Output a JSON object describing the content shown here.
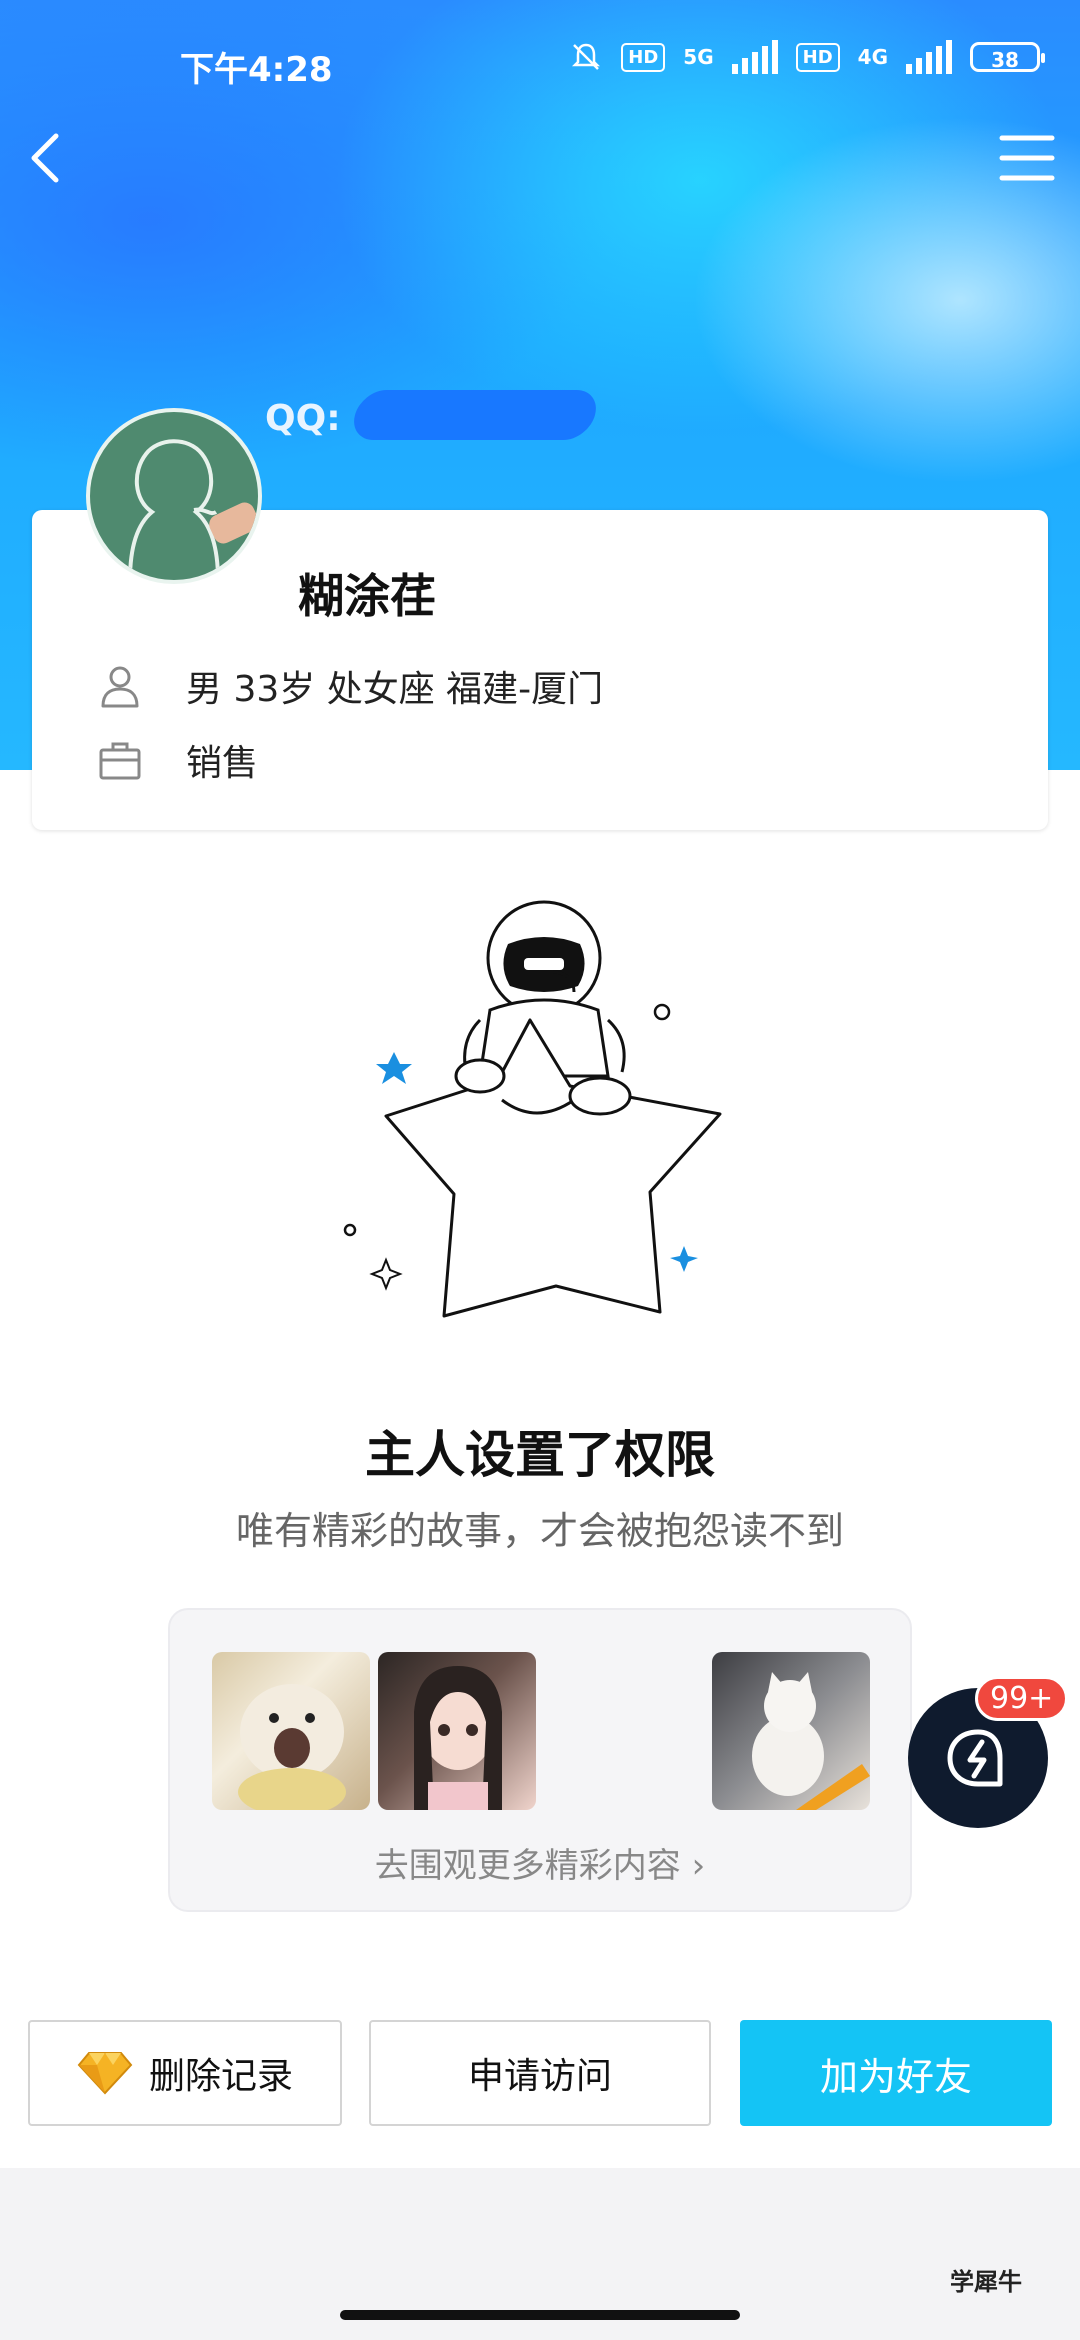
{
  "status_bar": {
    "time": "下午4:28",
    "network_1": "5G",
    "network_2": "4G",
    "hd_1": "HD",
    "hd_2": "HD",
    "battery": "38"
  },
  "header": {
    "qq_label": "QQ:"
  },
  "profile": {
    "nickname": "糊涂荏",
    "basic_info": "男  33岁  处女座  福建-厦门",
    "occupation": "销售"
  },
  "privacy": {
    "title": "主人设置了权限",
    "subtitle": "唯有精彩的故事，才会被抱怨读不到"
  },
  "discover": {
    "link_text": "去围观更多精彩内容 ›"
  },
  "float_badge": {
    "count": "99+"
  },
  "actions": {
    "delete_label": "删除记录",
    "request_label": "申请访问",
    "add_friend_label": "加为好友"
  },
  "watermark": "学犀牛",
  "colors": {
    "accent": "#14c4f5",
    "badge": "#f0483e",
    "header_blue": "#1ea8ff"
  }
}
